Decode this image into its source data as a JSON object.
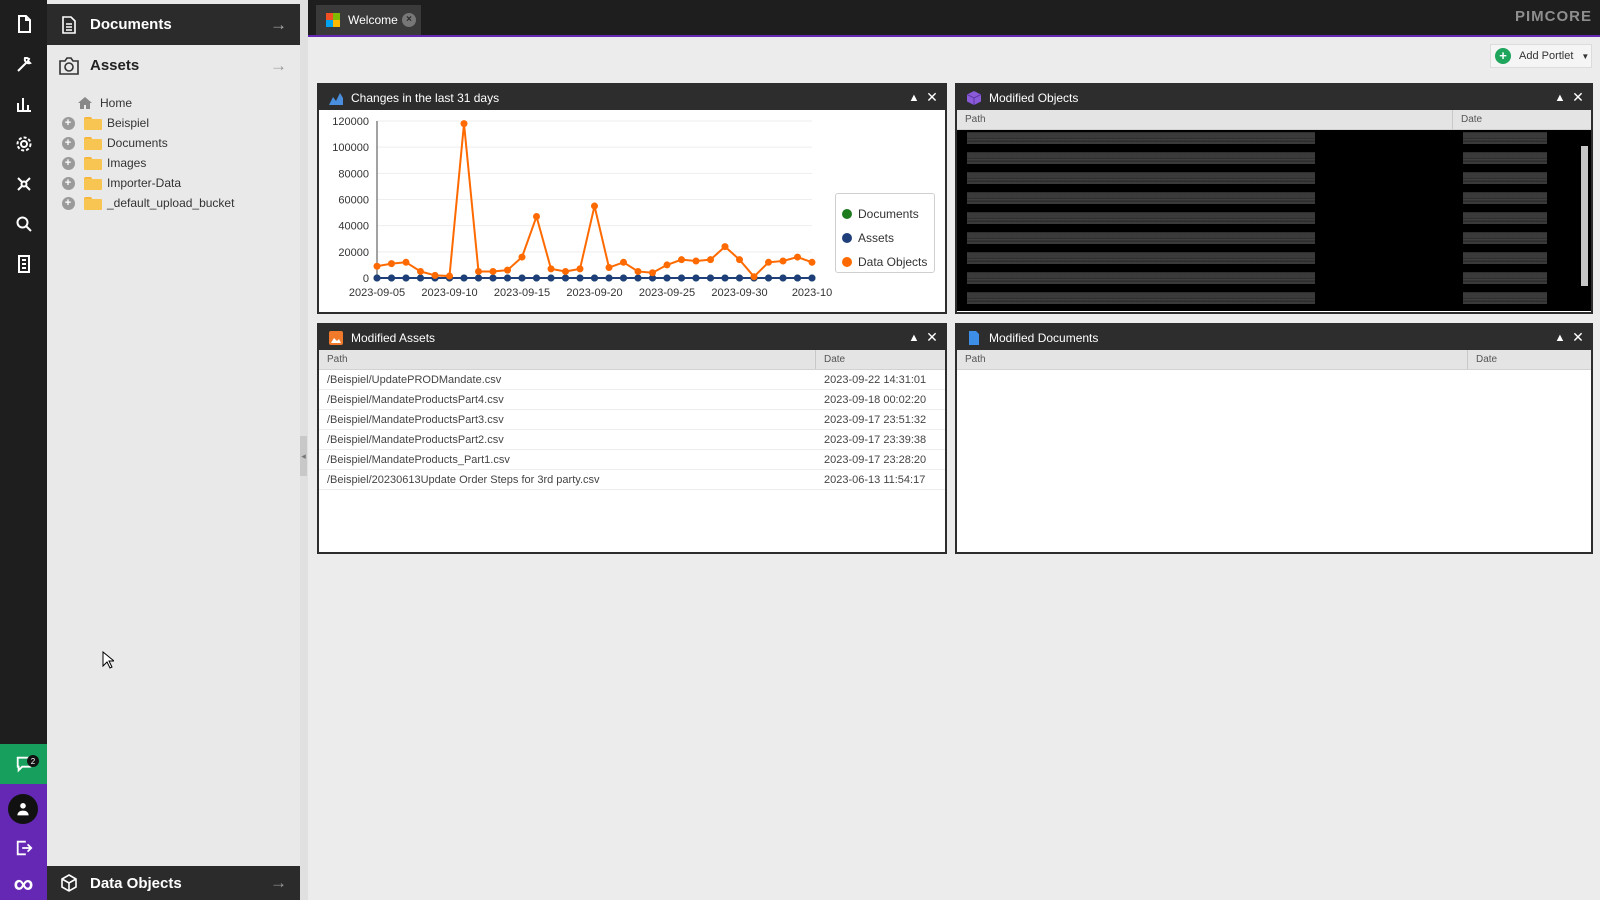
{
  "topbar": {
    "tab_label": "Welcome",
    "brand": "PIMCORE"
  },
  "rail": {
    "notifications_count": "2"
  },
  "sidebar": {
    "documents_label": "Documents",
    "assets_label": "Assets",
    "data_objects_label": "Data Objects",
    "tree": {
      "home": "Home",
      "items": [
        "Beispiel",
        "Documents",
        "Images",
        "Importer-Data",
        "_default_upload_bucket"
      ]
    }
  },
  "toolbar": {
    "add_portlet_label": "Add Portlet"
  },
  "portlets": {
    "chart": {
      "title": "Changes in the last 31 days"
    },
    "objects": {
      "title": "Modified Objects",
      "col_path": "Path",
      "col_date": "Date"
    },
    "assets": {
      "title": "Modified Assets",
      "col_path": "Path",
      "col_date": "Date",
      "rows": [
        {
          "path": "/Beispiel/UpdatePRODMandate.csv",
          "date": "2023-09-22 14:31:01"
        },
        {
          "path": "/Beispiel/MandateProductsPart4.csv",
          "date": "2023-09-18 00:02:20"
        },
        {
          "path": "/Beispiel/MandateProductsPart3.csv",
          "date": "2023-09-17 23:51:32"
        },
        {
          "path": "/Beispiel/MandateProductsPart2.csv",
          "date": "2023-09-17 23:39:38"
        },
        {
          "path": "/Beispiel/MandateProducts_Part1.csv",
          "date": "2023-09-17 23:28:20"
        },
        {
          "path": "/Beispiel/20230613Update Order Steps for 3rd party.csv",
          "date": "2023-06-13 11:54:17"
        }
      ]
    },
    "documents": {
      "title": "Modified Documents",
      "col_path": "Path",
      "col_date": "Date"
    }
  },
  "chart_data": {
    "type": "line",
    "title": "",
    "xlabel": "",
    "ylabel": "",
    "ylim": [
      0,
      120000
    ],
    "yticks": [
      0,
      20000,
      40000,
      60000,
      80000,
      100000,
      120000
    ],
    "xtick_labels": [
      "2023-09-05",
      "2023-09-10",
      "2023-09-15",
      "2023-09-20",
      "2023-09-25",
      "2023-09-30",
      "2023-10"
    ],
    "x": [
      "2023-09-05",
      "2023-09-06",
      "2023-09-07",
      "2023-09-08",
      "2023-09-09",
      "2023-09-10",
      "2023-09-11",
      "2023-09-12",
      "2023-09-13",
      "2023-09-14",
      "2023-09-15",
      "2023-09-16",
      "2023-09-17",
      "2023-09-18",
      "2023-09-19",
      "2023-09-20",
      "2023-09-21",
      "2023-09-22",
      "2023-09-23",
      "2023-09-24",
      "2023-09-25",
      "2023-09-26",
      "2023-09-27",
      "2023-09-28",
      "2023-09-29",
      "2023-09-30",
      "2023-10-01",
      "2023-10-02",
      "2023-10-03",
      "2023-10-04",
      "2023-10-05"
    ],
    "legend_position": "right",
    "series": [
      {
        "name": "Documents",
        "color": "#1e7b1e",
        "values": [
          0,
          0,
          0,
          0,
          0,
          0,
          0,
          0,
          0,
          0,
          0,
          0,
          0,
          0,
          0,
          0,
          0,
          0,
          0,
          0,
          0,
          0,
          0,
          0,
          0,
          0,
          0,
          0,
          0,
          0,
          0
        ]
      },
      {
        "name": "Assets",
        "color": "#1f3f7a",
        "values": [
          0,
          0,
          0,
          0,
          0,
          0,
          0,
          0,
          0,
          0,
          0,
          0,
          0,
          0,
          0,
          0,
          0,
          0,
          0,
          0,
          0,
          0,
          0,
          0,
          0,
          0,
          0,
          0,
          0,
          0,
          0
        ]
      },
      {
        "name": "Data Objects",
        "color": "#ff6a00",
        "values": [
          9000,
          11000,
          12000,
          5000,
          2000,
          1500,
          118000,
          5000,
          5000,
          6000,
          16000,
          47000,
          7000,
          5000,
          7000,
          55000,
          8000,
          12000,
          5000,
          4000,
          10000,
          14000,
          13000,
          14000,
          24000,
          14000,
          1000,
          12000,
          13000,
          16000,
          12000
        ]
      }
    ]
  },
  "icons": {
    "rail": [
      "document-icon",
      "wrench-icon",
      "chart-icon",
      "gear-icon",
      "network-icon",
      "search-icon",
      "report-icon"
    ]
  }
}
